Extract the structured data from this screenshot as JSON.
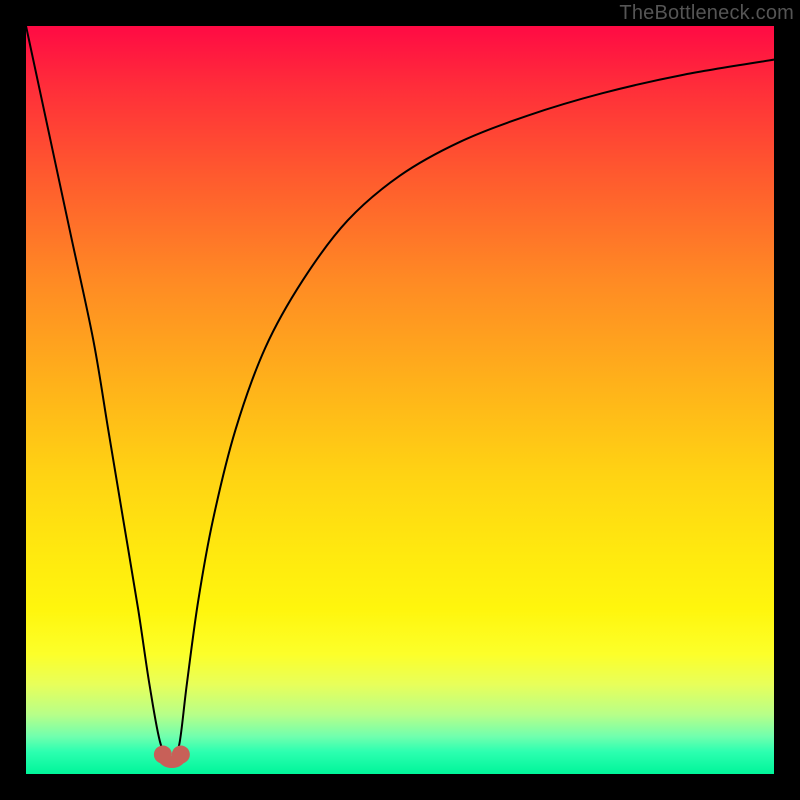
{
  "watermark": "TheBottleneck.com",
  "chart_data": {
    "type": "line",
    "title": "",
    "xlabel": "",
    "ylabel": "",
    "xlim": [
      0,
      100
    ],
    "ylim": [
      0,
      100
    ],
    "series": [
      {
        "name": "bottleneck-curve",
        "x": [
          0,
          3,
          6,
          9,
          11,
          13,
          15,
          16.5,
          18,
          19.5,
          20.5,
          21.5,
          23,
          25,
          28,
          32,
          37,
          43,
          50,
          58,
          67,
          77,
          88,
          100
        ],
        "values": [
          100,
          86,
          72,
          58,
          46,
          34,
          22,
          12,
          4,
          2,
          4,
          12,
          23,
          34,
          46,
          57,
          66,
          74,
          80,
          84.5,
          88,
          91,
          93.5,
          95.5
        ]
      }
    ],
    "markers": [
      {
        "name": "dip-left",
        "x": 18.3,
        "y": 2.6
      },
      {
        "name": "dip-right",
        "x": 20.7,
        "y": 2.6
      }
    ],
    "gradient_stops": [
      {
        "pos": 0,
        "color": "#ff0a44"
      },
      {
        "pos": 20,
        "color": "#ff5a2e"
      },
      {
        "pos": 48,
        "color": "#ffb21a"
      },
      {
        "pos": 78,
        "color": "#fff60d"
      },
      {
        "pos": 100,
        "color": "#00f59a"
      }
    ],
    "marker_color": "#c86058"
  }
}
